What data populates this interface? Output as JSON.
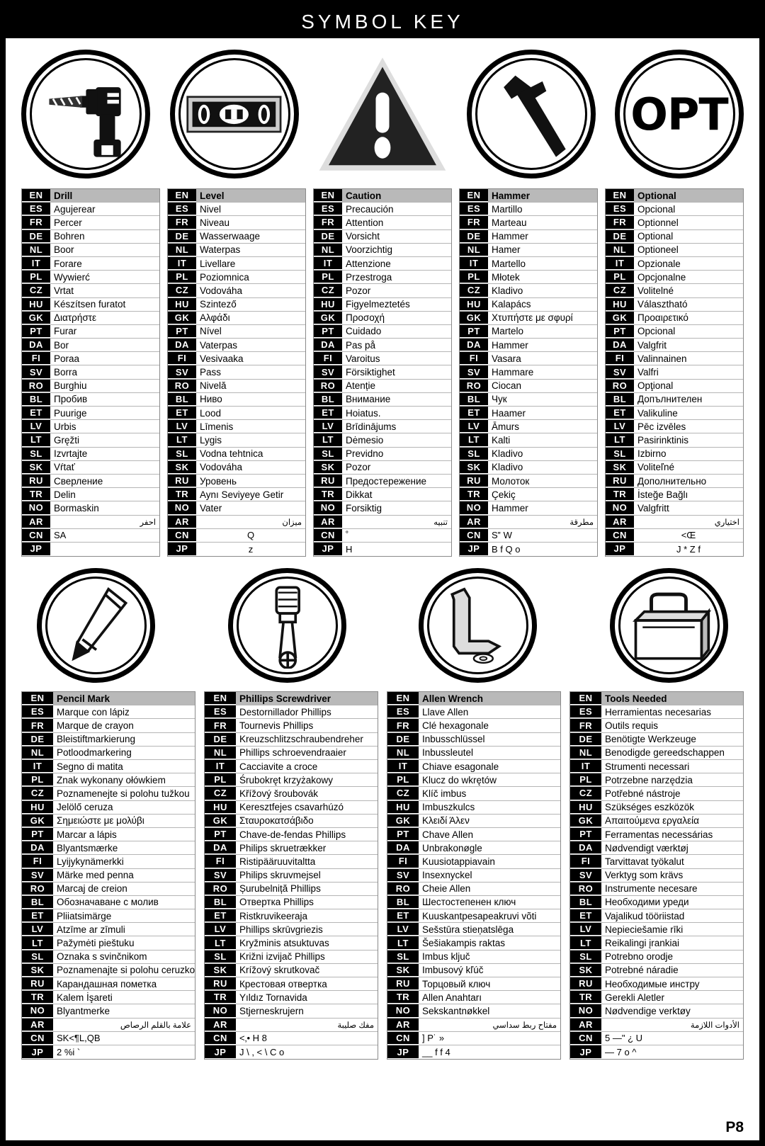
{
  "document": {
    "title": "SYMBOL KEY",
    "page_number": "P8"
  },
  "symbols_top": [
    {
      "name": "drill-symbol",
      "icon": "drill-icon",
      "label": "Drill"
    },
    {
      "name": "level-symbol",
      "icon": "spirit-level-icon",
      "label": "Level"
    },
    {
      "name": "caution-symbol",
      "icon": "warning-triangle-icon",
      "label": "Caution"
    },
    {
      "name": "hammer-symbol",
      "icon": "hammer-icon",
      "label": "Hammer"
    },
    {
      "name": "optional-symbol",
      "icon": "opt-text-icon",
      "label": "OPT"
    }
  ],
  "symbols_bottom": [
    {
      "name": "pencil-symbol",
      "icon": "pencil-icon",
      "label": "Pencil Mark"
    },
    {
      "name": "screwdriver-symbol",
      "icon": "phillips-screwdriver-icon",
      "label": "Phillips Screwdriver"
    },
    {
      "name": "allen-wrench-symbol",
      "icon": "allen-wrench-icon",
      "label": "Allen Wrench"
    },
    {
      "name": "toolbox-symbol",
      "icon": "toolbox-icon",
      "label": "Tools Needed"
    }
  ],
  "language_codes": [
    "EN",
    "ES",
    "FR",
    "DE",
    "NL",
    "IT",
    "PL",
    "CZ",
    "HU",
    "GK",
    "PT",
    "DA",
    "FI",
    "SV",
    "RO",
    "BL",
    "ET",
    "LV",
    "LT",
    "SL",
    "SK",
    "RU",
    "TR",
    "NO",
    "AR",
    "CN",
    "JP"
  ],
  "tables_top": [
    {
      "id": "drill",
      "terms": [
        "Drill",
        "Agujerear",
        "Percer",
        "Bohren",
        "Boor",
        "Forare",
        "Wywierć",
        "Vrtat",
        "Készítsen furatot",
        "Διατρήστε",
        "Furar",
        "Bor",
        "Poraa",
        "Borra",
        "Burghiu",
        "Пробив",
        "Puurige",
        "Urbis",
        "Gręžti",
        "Izvrtajte",
        "Vŕtať",
        "Сверление",
        "Delin",
        "Bormaskin",
        "احفر",
        "SA",
        ""
      ]
    },
    {
      "id": "level",
      "terms": [
        "Level",
        "Nivel",
        "Niveau",
        "Wasserwaage",
        "Waterpas",
        "Livellare",
        "Poziomnica",
        "Vodováha",
        "Szintező",
        "Αλφάδι",
        "Nível",
        "Vaterpas",
        "Vesivaaka",
        "Pass",
        "Nivelă",
        "Ниво",
        "Lood",
        "Līmenis",
        "Lygis",
        "Vodna tehtnica",
        "Vodováha",
        "Уровень",
        "Aynı Seviyeye Getir",
        "Vater",
        "ميزان",
        "Q",
        "z"
      ]
    },
    {
      "id": "caution",
      "terms": [
        "Caution",
        "Precaución",
        "Attention",
        "Vorsicht",
        "Voorzichtig",
        "Attenzione",
        "Przestroga",
        "Pozor",
        "Figyelmeztetés",
        "Προσοχή",
        "Cuidado",
        "Pas på",
        "Varoitus",
        "Försiktighet",
        "Atenție",
        "Внимание",
        "Hoiatus.",
        "Brīdinājums",
        "Dėmesio",
        "Previdno",
        "Pozor",
        "Предостережение",
        "Dikkat",
        "Forsiktig",
        "تنبيه",
        "˚",
        "H"
      ]
    },
    {
      "id": "hammer",
      "terms": [
        "Hammer",
        "Martillo",
        "Marteau",
        "Hammer",
        "Hamer",
        "Martello",
        "Młotek",
        "Kladivo",
        "Kalapács",
        "Χτυπήστε με σφυρί",
        "Martelo",
        "Hammer",
        "Vasara",
        "Hammare",
        "Ciocan",
        "Чук",
        "Haamer",
        "Āmurs",
        "Kalti",
        "Kladivo",
        "Kladivo",
        "Молоток",
        "Çekiç",
        "Hammer",
        "مطرقة",
        "S‟ W",
        "B f Q o"
      ]
    },
    {
      "id": "optional",
      "terms": [
        "Optional",
        "Opcional",
        "Optionnel",
        "Optional",
        "Optioneel",
        "Opzionale",
        "Opcjonalne",
        "Volitelné",
        "Választható",
        "Προαιρετικό",
        "Opcional",
        "Valgfrit",
        "Valinnainen",
        "Valfri",
        "Opţional",
        "Допълнителен",
        "Valikuline",
        "Pēc izvēles",
        "Pasirinktinis",
        "Izbirno",
        "Voliteľné",
        "Дополнительно",
        "İsteğe Bağlı",
        "Valgfritt",
        "اختياري",
        "<Œ",
        "J * Z f"
      ]
    }
  ],
  "tables_bottom": [
    {
      "id": "pencil-mark",
      "terms": [
        "Pencil Mark",
        "Marque con lápiz",
        "Marque de crayon",
        "Bleistiftmarkierung",
        "Potloodmarkering",
        "Segno di matita",
        "Znak wykonany ołówkiem",
        "Poznamenejte si polohu tužkou",
        "Jelölő ceruza",
        "Σημειώστε με μολύβι",
        "Marcar a lápis",
        "Blyantsmærke",
        "Lyijykynämerkki",
        "Märke med penna",
        "Marcaj de creion",
        "Обозначаване с молив",
        "Pliiatsimärge",
        "Atzīme ar zīmuli",
        "Pažymėti pieštuku",
        "Oznaka s svinčnikom",
        "Poznamenajte si polohu ceruzkou",
        "Карандашная пометка",
        "Kalem İşareti",
        "Blyantmerke",
        "علامة بالقلم الرصاص",
        "SK<¶L,QB",
        "2 %i       `"
      ]
    },
    {
      "id": "phillips-screwdriver",
      "terms": [
        "Phillips Screwdriver",
        "Destornillador Phillips",
        "Tournevis Phillips",
        "Kreuzschlitzschraubendreher",
        "Phillips schroevendraaier",
        "Cacciavite a croce",
        "Śrubokręt krzyżakowy",
        "Křížový šroubovák",
        "Keresztfejes csavarhúzó",
        "Σταυροκατσάβιδο",
        "Chave-de-fendas Phillips",
        "Philips skruetrækker",
        "Ristipääruuvitaltta",
        "Philips skruvmejsel",
        "Șurubelniță Phillips",
        "Отвертка Phillips",
        "Ristkruvikeeraja",
        "Phillips skrūvgriezis",
        "Kryžminis atsuktuvas",
        "Križni izvijač Phillips",
        "Krížový skrutkovač",
        "Крестовая отвертка",
        "Yıldız Tornavida",
        "Stjerneskrujern",
        "مفك صليبة",
        "<‚•  H 8",
        "J \\ , < \\   C o"
      ]
    },
    {
      "id": "allen-wrench",
      "terms": [
        "Allen Wrench",
        "Llave Allen",
        "Clé hexagonale",
        "Inbusschlüssel",
        "Inbussleutel",
        "Chiave esagonale",
        "Klucz do wkrętów",
        "Klíč imbus",
        "Imbuszkulcs",
        "Κλειδί Άλεν",
        "Chave Allen",
        "Unbrakonøgle",
        "Kuusiotappiavain",
        "Insexnyckel",
        "Cheie Allen",
        "Шестостепенен ключ",
        "Kuuskantpesapeakruvi võti",
        "Sešstūra stieņatslēga",
        "Šešiakampis raktas",
        "Imbus ključ",
        "Imbusový kľúč",
        "Торцовый ключ",
        "Allen Anahtarı",
        "Sekskantnøkkel",
        "مفتاح ربط سداسي",
        "] P˙   »",
        "__ f   f 4"
      ]
    },
    {
      "id": "tools-needed",
      "terms": [
        "Tools Needed",
        "Herramientas necesarias",
        "Outils requis",
        "Benötigte Werkzeuge",
        "Benodigde gereedschappen",
        "Strumenti necessari",
        "Potrzebne narzędzia",
        "Potřebné nástroje",
        "Szükséges eszközök",
        "Απαιτούμενα εργαλεία",
        "Ferramentas necessárias",
        "Nødvendigt værktøj",
        "Tarvittavat työkalut",
        "Verktyg som krävs",
        "Instrumente necesare",
        "Необходими уреди",
        "Vajalikud tööriistad",
        "Nepieciešamie rīki",
        "Reikalingi įrankiai",
        "Potrebno orodje",
        "Potrebné náradie",
        "Необходимые инстру",
        "Gerekli Aletler",
        "Nødvendige verktøy",
        "الأدوات اللازمة",
        "5 —\" ¿ U",
        "— 7 o ^"
      ]
    }
  ]
}
